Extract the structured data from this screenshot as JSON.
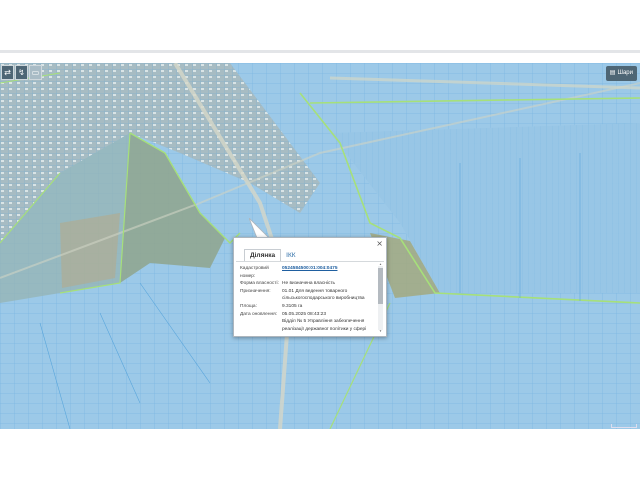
{
  "map": {
    "tools": [
      {
        "icon": "pan-icon",
        "glyph": "⇄"
      },
      {
        "icon": "measure-icon",
        "glyph": "↯"
      },
      {
        "icon": "ruler-icon",
        "glyph": "▭"
      }
    ],
    "layers_button": {
      "icon": "layers-icon",
      "label": "Шари"
    },
    "colors": {
      "parcel_fill": "#8ec7ee",
      "parcel_border": "#4a9fd8",
      "boundary_line": "#a6e07a",
      "road": "#d9dccf"
    }
  },
  "popup": {
    "tabs": [
      {
        "label": "Ділянка",
        "active": true
      },
      {
        "label": "ІКК",
        "active": false
      }
    ],
    "close_glyph": "×",
    "fields": [
      {
        "key": "Кадастровий номер:",
        "value": "0524584500:01:004:0475",
        "link": true
      },
      {
        "key": "Форма власності:",
        "value": "Не визначена власність",
        "link": false
      },
      {
        "key": "Призначення:",
        "value": "01.01 Для ведення товарного сільськогосподарського виробництва",
        "link": false
      },
      {
        "key": "Площа:",
        "value": "9.3105 га",
        "link": false
      },
      {
        "key": "Дата оновлення:",
        "value": "05.05.2025 08:43:23",
        "link": false
      },
      {
        "key": "",
        "value": "Відділ № 5 Управління забезпечення реалізації державної політики у сфері",
        "link": false
      }
    ]
  }
}
